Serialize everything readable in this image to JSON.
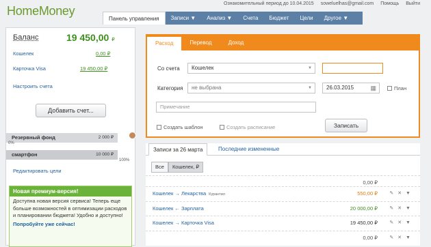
{
  "header": {
    "logo": "HomeMoney",
    "period": "Ознакомительный период до 10.04.2015",
    "email": "soweluelhas@gmail.com",
    "help": "Помощь",
    "logout": "Выйти"
  },
  "nav": [
    "Панель управления",
    "Записи ▼",
    "Анализ ▼",
    "Счета",
    "Бюджет",
    "Цели",
    "Другое ▼"
  ],
  "left": {
    "balance_label": "Баланс",
    "balance_value": "19 450,00",
    "currency": "₽",
    "accounts": [
      {
        "name": "Кошелек",
        "value": "0,00 ₽"
      },
      {
        "name": "Карточка Visa",
        "value": "19 450,00 ₽"
      }
    ],
    "configure": "Настроить счета",
    "add_button": "Добавить счет...",
    "goals": [
      {
        "name": "Резервный фонд",
        "value": "2 000 ₽",
        "pct_label": "0%",
        "pct": 0
      },
      {
        "name": "смартфон",
        "value": "10 000 ₽",
        "pct_label": "100%",
        "pct": 100
      }
    ],
    "edit_goals": "Редактировать цели",
    "promo": {
      "title": "Новая премиум-версия!",
      "text": "Доступна новая версия сервиса! Теперь еще больше возможностей в оптимизации расходов и планировании бюджета! Удобно и доступно!",
      "cta": "Попробуйте уже сейчас!"
    }
  },
  "form": {
    "tabs": [
      "Расход",
      "Перевод",
      "Доход"
    ],
    "account_label": "Со счета",
    "account_value": "Кошелек",
    "category_label": "Категория",
    "category_value": "не выбрана",
    "date": "26.03.2015",
    "plan_label": "План",
    "note_placeholder": "Примечание",
    "template_label": "Создать шаблон",
    "schedule_label": "Создать расписание",
    "save": "Записать"
  },
  "records": {
    "tab_active": "Записи за 26 марта",
    "tab_other": "Последние измененные",
    "filter_all": "Все",
    "filter_wallet": "Кошелек, ₽",
    "rows": [
      {
        "desc": "",
        "tag": "",
        "amount": "0,00 ₽",
        "color": "#555555"
      },
      {
        "desc": "Кошелек → Лекарства",
        "tag": "Курантил",
        "amount": "550,00 ₽",
        "color": "#e07b10"
      },
      {
        "desc": "Кошелек ← Зарплата",
        "tag": "",
        "amount": "20 000,00 ₽",
        "color": "#3d8f1b"
      },
      {
        "desc": "Кошелек → Карточка Visa",
        "tag": "",
        "amount": "19 450,00 ₽",
        "color": "#333333"
      },
      {
        "desc": "",
        "tag": "",
        "amount": "0,00 ₽",
        "color": "#555555"
      }
    ]
  }
}
